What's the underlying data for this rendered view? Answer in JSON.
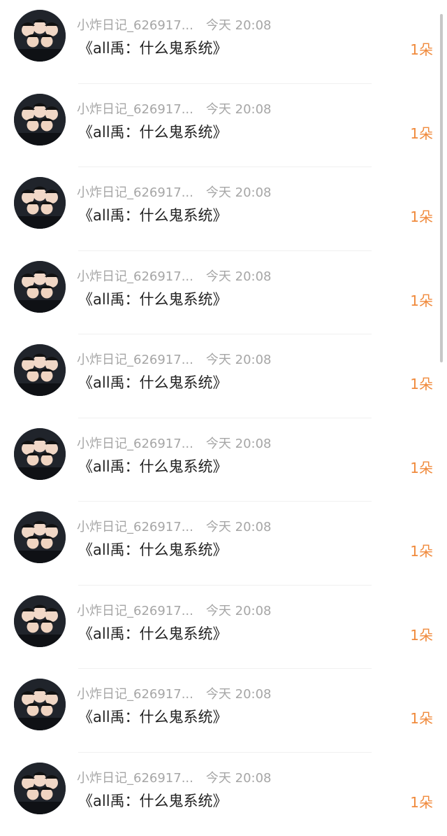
{
  "messages": [
    {
      "sender": "小炸日记_626917...",
      "time": "今天 20:08",
      "content": "《all禹：什么鬼系统》",
      "count": "1朵"
    },
    {
      "sender": "小炸日记_626917...",
      "time": "今天 20:08",
      "content": "《all禹：什么鬼系统》",
      "count": "1朵"
    },
    {
      "sender": "小炸日记_626917...",
      "time": "今天 20:08",
      "content": "《all禹：什么鬼系统》",
      "count": "1朵"
    },
    {
      "sender": "小炸日记_626917...",
      "time": "今天 20:08",
      "content": "《all禹：什么鬼系统》",
      "count": "1朵"
    },
    {
      "sender": "小炸日记_626917...",
      "time": "今天 20:08",
      "content": "《all禹：什么鬼系统》",
      "count": "1朵"
    },
    {
      "sender": "小炸日记_626917...",
      "time": "今天 20:08",
      "content": "《all禹：什么鬼系统》",
      "count": "1朵"
    },
    {
      "sender": "小炸日记_626917...",
      "time": "今天 20:08",
      "content": "《all禹：什么鬼系统》",
      "count": "1朵"
    },
    {
      "sender": "小炸日记_626917...",
      "time": "今天 20:08",
      "content": "《all禹：什么鬼系统》",
      "count": "1朵"
    },
    {
      "sender": "小炸日记_626917...",
      "time": "今天 20:08",
      "content": "《all禹：什么鬼系统》",
      "count": "1朵"
    },
    {
      "sender": "小炸日记_626917...",
      "time": "今天 20:08",
      "content": "《all禹：什么鬼系统》",
      "count": "1朵"
    }
  ],
  "colors": {
    "accent": "#f08a3c",
    "meta_text": "#a6a6a6",
    "body_text": "#222222"
  },
  "icons": {
    "avatar": "group-photo-avatar"
  }
}
